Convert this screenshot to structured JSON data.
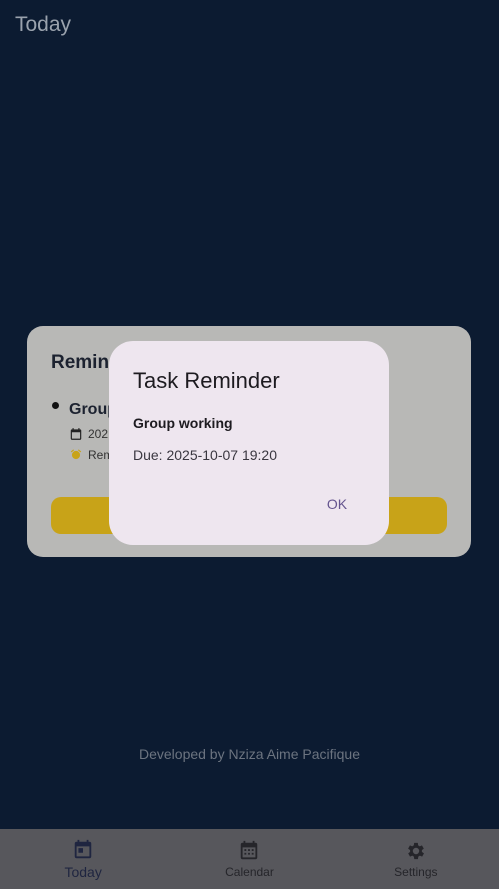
{
  "app_bar": {
    "title": "Today"
  },
  "reminder_card": {
    "title": "Remind",
    "task_name": "Group",
    "date_text": "202",
    "reminder_text": "Rem"
  },
  "footer": {
    "text": "Developed by Nziza Aime Pacifique"
  },
  "dialog": {
    "title": "Task Reminder",
    "task": "Group working",
    "due": "Due: 2025-10-07 19:20",
    "ok_label": "OK"
  },
  "bottom_nav": {
    "items": [
      {
        "label": "Today",
        "icon": "calendar-today-icon",
        "active": true
      },
      {
        "label": "Calendar",
        "icon": "calendar-month-icon",
        "active": false
      },
      {
        "label": "Settings",
        "icon": "gear-icon",
        "active": false
      }
    ]
  },
  "colors": {
    "background": "#0c1b31",
    "card": "#b8b8b6",
    "card_button": "#c8a318",
    "dialog": "#eee6ef",
    "accent": "#65558f",
    "alarm_icon": "#c8a318"
  }
}
